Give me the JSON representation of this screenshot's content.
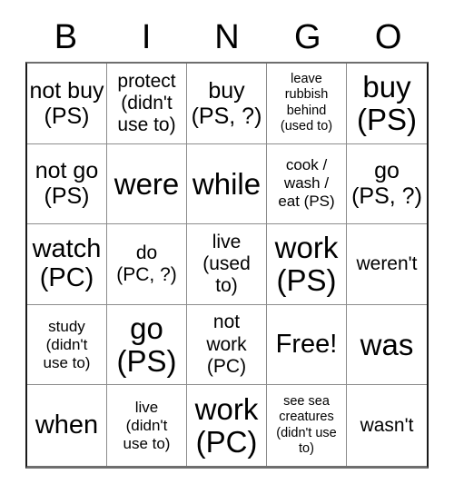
{
  "card": {
    "title": "BINGO",
    "header_letters": [
      "B",
      "I",
      "N",
      "G",
      "O"
    ],
    "rows": [
      [
        {
          "text": "not buy\n(PS)",
          "size": "fs-lg"
        },
        {
          "text": "protect\n(didn't\nuse to)",
          "size": "fs-md"
        },
        {
          "text": "buy\n(PS, ?)",
          "size": "fs-lg"
        },
        {
          "text": "leave\nrubbish\nbehind\n(used to)",
          "size": "fs-xs"
        },
        {
          "text": "buy\n(PS)",
          "size": "fs-xxl"
        }
      ],
      [
        {
          "text": "not go\n(PS)",
          "size": "fs-lg"
        },
        {
          "text": "were",
          "size": "fs-xxl"
        },
        {
          "text": "while",
          "size": "fs-xxl"
        },
        {
          "text": "cook /\nwash /\neat (PS)",
          "size": "fs-sm"
        },
        {
          "text": "go\n(PS, ?)",
          "size": "fs-lg"
        }
      ],
      [
        {
          "text": "watch\n(PC)",
          "size": "fs-xl"
        },
        {
          "text": "do\n(PC, ?)",
          "size": "fs-md"
        },
        {
          "text": "live\n(used\nto)",
          "size": "fs-md"
        },
        {
          "text": "work\n(PS)",
          "size": "fs-xxl"
        },
        {
          "text": "weren't",
          "size": "fs-md"
        }
      ],
      [
        {
          "text": "study\n(didn't\nuse to)",
          "size": "fs-sm"
        },
        {
          "text": "go\n(PS)",
          "size": "fs-xxl"
        },
        {
          "text": "not\nwork\n(PC)",
          "size": "fs-md"
        },
        {
          "text": "Free!",
          "size": "fs-xl"
        },
        {
          "text": "was",
          "size": "fs-xxl"
        }
      ],
      [
        {
          "text": "when",
          "size": "fs-xl"
        },
        {
          "text": "live\n(didn't\nuse to)",
          "size": "fs-sm"
        },
        {
          "text": "work\n(PC)",
          "size": "fs-xxl"
        },
        {
          "text": "see sea\ncreatures\n(didn't use\nto)",
          "size": "fs-xs"
        },
        {
          "text": "wasn't",
          "size": "fs-md"
        }
      ]
    ],
    "free_space": {
      "row": 3,
      "column": 3,
      "label": "Free!"
    },
    "colors": {
      "text": "#000000",
      "background": "#ffffff",
      "grid_line": "#8c8c8c",
      "outer_border": "#1a1a1a"
    }
  }
}
